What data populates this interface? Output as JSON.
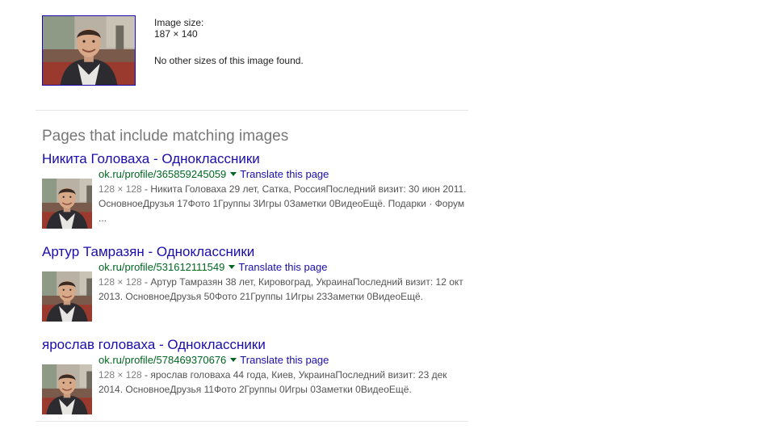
{
  "image_info": {
    "size_label": "Image size:",
    "size_value": "187 × 140",
    "no_other_sizes": "No other sizes of this image found."
  },
  "section": {
    "heading": "Pages that include matching images"
  },
  "results": [
    {
      "title": "Никита Головаха - Одноклассники",
      "url": "ok.ru/profile/365859245059",
      "translate": "Translate this page",
      "dims": "128 × 128",
      "snippet": " - Никита Головаха 29 лет, Сатка, РоссияПоследний визит: 30 июн 2011. ОсновноеДрузья 17Фото 1Группы 3Игры 0Заметки 0ВидеоЕщё. Подарки · Форум ..."
    },
    {
      "title": "Артур Тамразян - Одноклассники",
      "url": "ok.ru/profile/531612111549",
      "translate": "Translate this page",
      "dims": "128 × 128",
      "snippet": " - Артур Тамразян 38 лет, Кировоград, УкраинаПоследний визит: 12 окт 2013. ОсновноеДрузья 50Фото 21Группы 1Игры 23Заметки 0ВидеоЕщё."
    },
    {
      "title": "ярослав головаха - Одноклассники",
      "url": "ok.ru/profile/578469370676",
      "translate": "Translate this page",
      "dims": "128 × 128",
      "snippet": " - ярослав головаха 44 года, Киев, УкраинаПоследний визит: 23 дек 2014. ОсновноеДрузья 11Фото 2Группы 0Игры 0Заметки 0ВидеоЕщё."
    }
  ],
  "colors": {
    "link": "#1a0dab",
    "url": "#006621",
    "heading": "#777777",
    "snippet": "#545454"
  }
}
